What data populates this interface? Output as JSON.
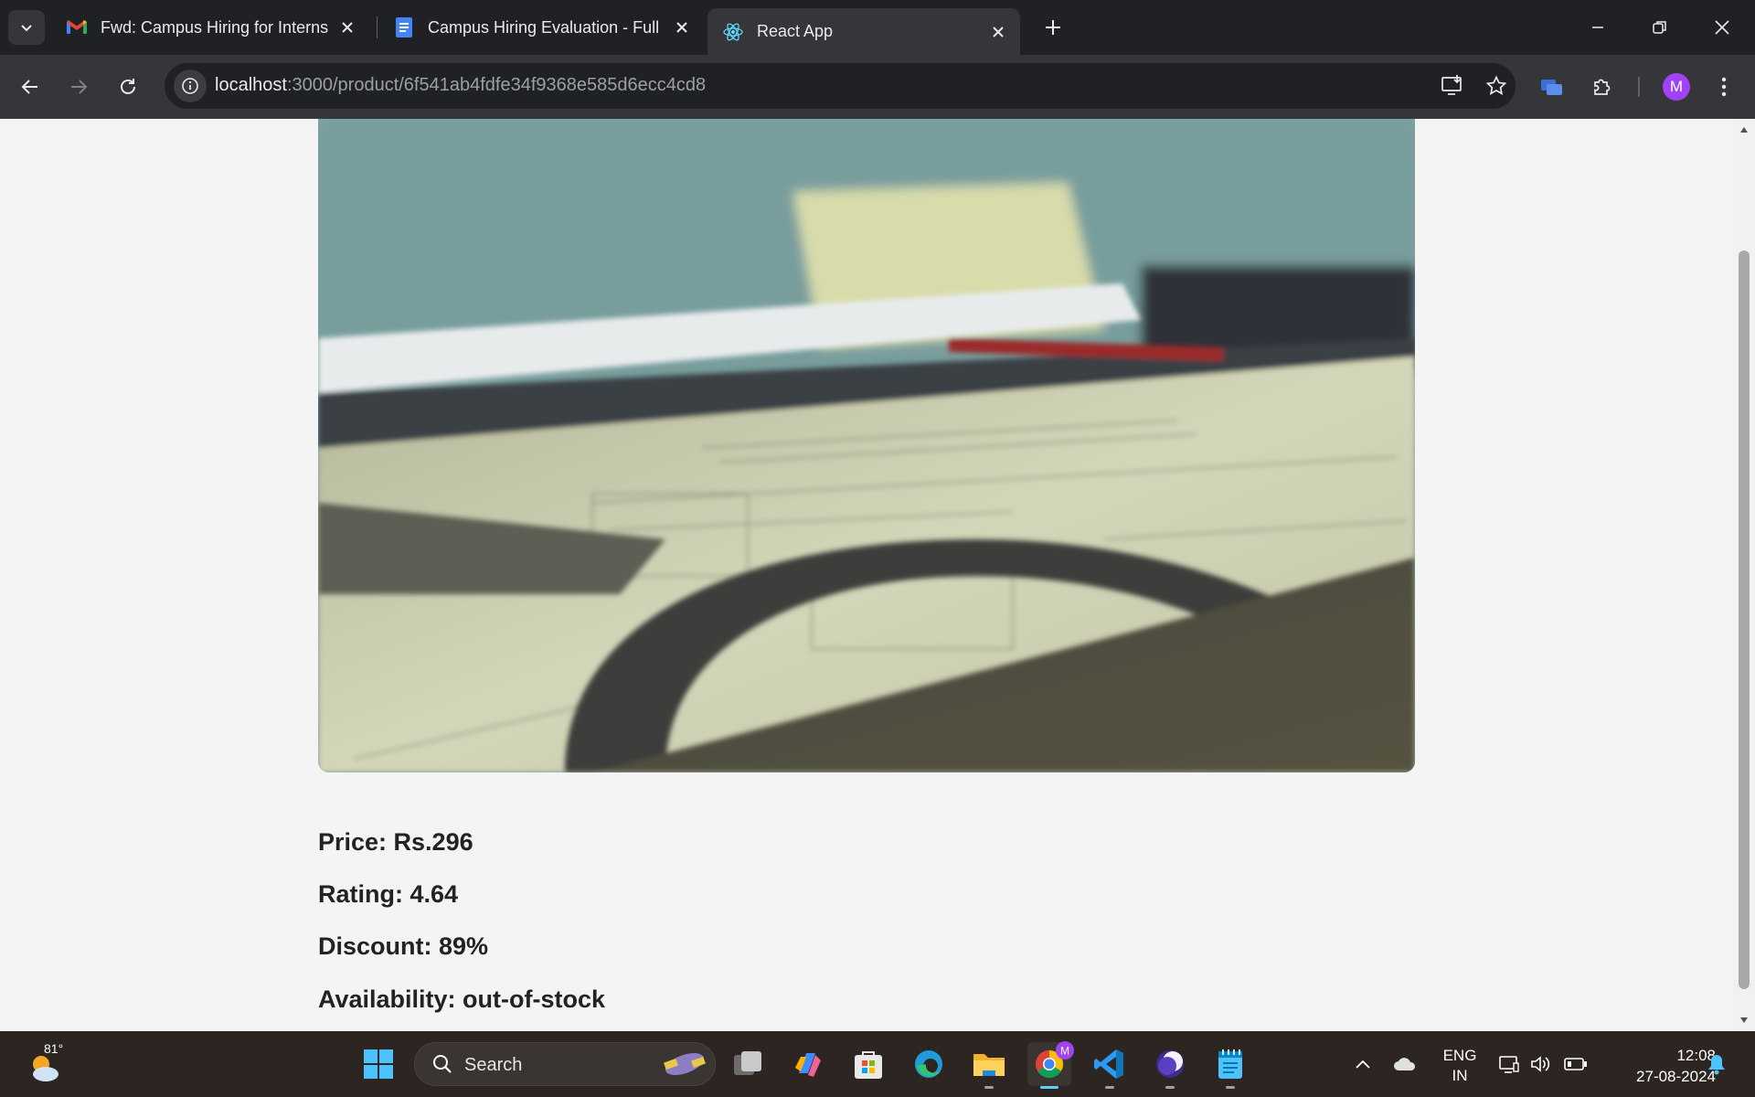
{
  "browser": {
    "tabs": [
      {
        "title": "Fwd: Campus Hiring for Interns",
        "favicon": "gmail-icon",
        "active": false
      },
      {
        "title": "Campus Hiring Evaluation - Full",
        "favicon": "google-docs-icon",
        "active": false
      },
      {
        "title": "React App",
        "favicon": "react-icon",
        "active": true
      }
    ],
    "url_host": "localhost",
    "url_path": ":3000/product/6f541ab4fdfe34f9368e585d6ecc4cd8",
    "profile_initial": "M"
  },
  "product": {
    "image_alt": "product-image",
    "price_text": "Price: Rs.296",
    "rating_text": "Rating: 4.64",
    "discount_text": "Discount: 89%",
    "availability_text": "Availability: out-of-stock"
  },
  "taskbar": {
    "weather_temp": "81°",
    "search_label": "Search",
    "language_line1": "ENG",
    "language_line2": "IN",
    "time": "12:08",
    "date": "27-08-2024",
    "accent_color": "#60cdff"
  }
}
